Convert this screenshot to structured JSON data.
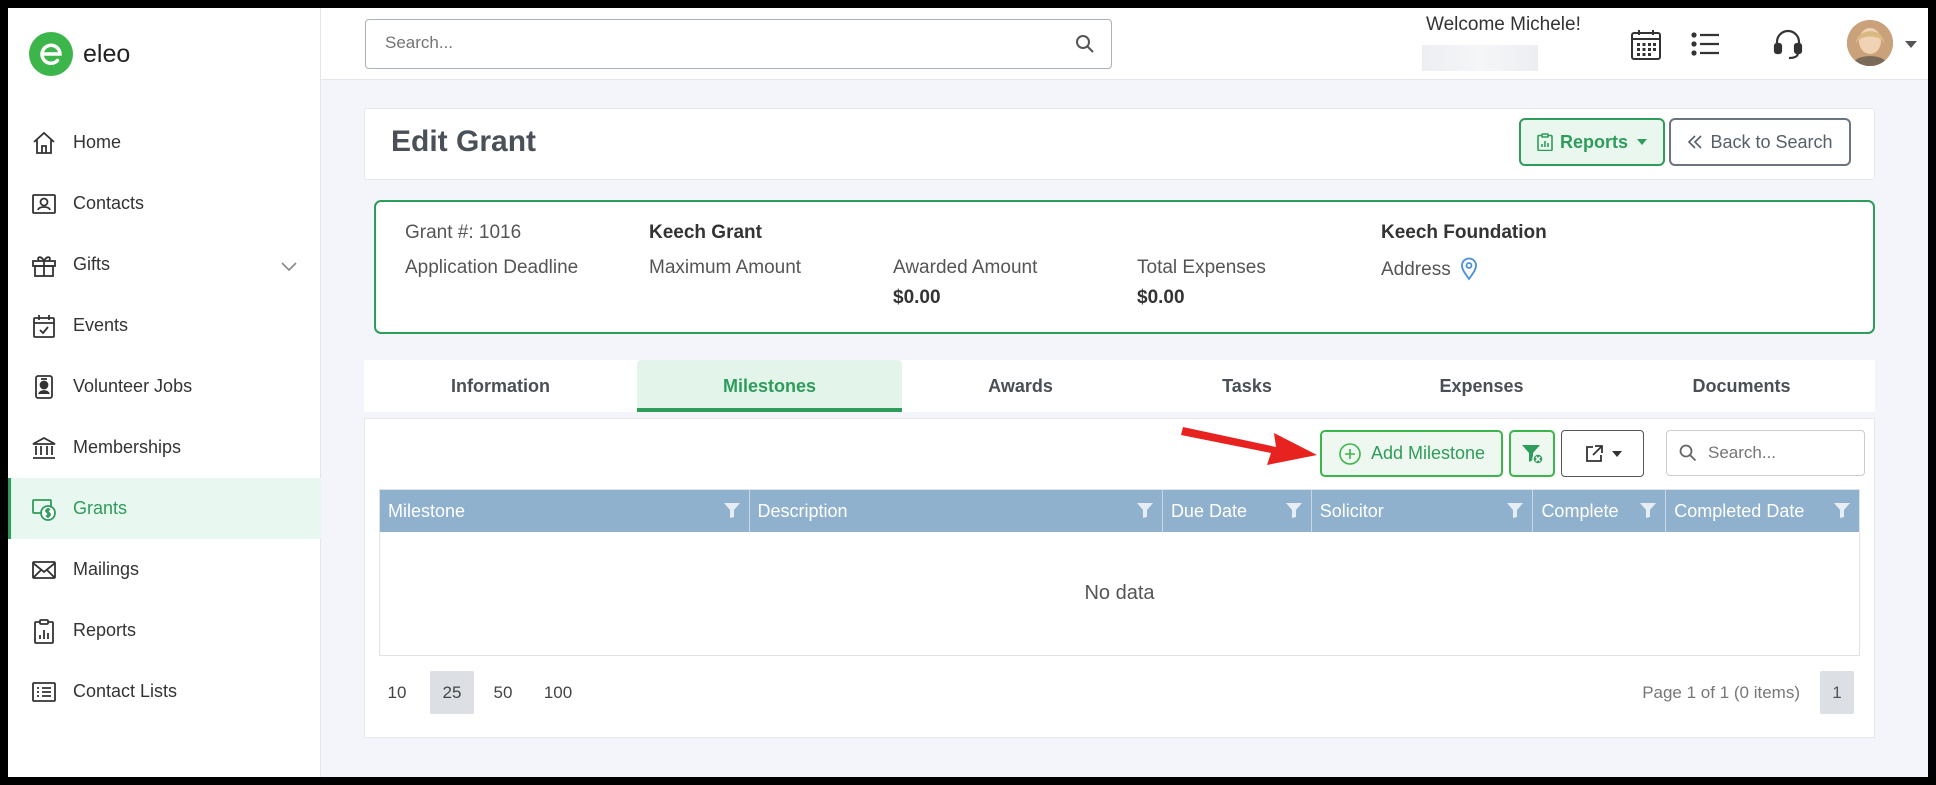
{
  "brand": {
    "name": "eleo",
    "accent": "#2e9c5a",
    "logo_color": "#3cb54a"
  },
  "sidebar": {
    "items": [
      {
        "label": "Home",
        "icon": "home-icon"
      },
      {
        "label": "Contacts",
        "icon": "contacts-icon"
      },
      {
        "label": "Gifts",
        "icon": "gift-icon",
        "expandable": true
      },
      {
        "label": "Events",
        "icon": "calendar-check-icon"
      },
      {
        "label": "Volunteer Jobs",
        "icon": "badge-icon"
      },
      {
        "label": "Memberships",
        "icon": "bank-icon"
      },
      {
        "label": "Grants",
        "icon": "grant-money-icon",
        "active": true
      },
      {
        "label": "Mailings",
        "icon": "envelope-icon"
      },
      {
        "label": "Reports",
        "icon": "clipboard-chart-icon"
      },
      {
        "label": "Contact Lists",
        "icon": "list-icon"
      }
    ]
  },
  "topbar": {
    "search_placeholder": "Search...",
    "welcome": "Welcome Michele!",
    "icons": [
      "calendar-grid-icon",
      "list-bullets-icon",
      "headset-icon",
      "user-avatar",
      "caret-down-icon"
    ]
  },
  "header": {
    "title": "Edit Grant",
    "reports_label": "Reports",
    "back_label": "Back to Search"
  },
  "summary": {
    "grant_number": "Grant #: 1016",
    "application_deadline": "Application Deadline",
    "grant_name": "Keech Grant",
    "maximum_amount_label": "Maximum Amount",
    "awarded_amount_label": "Awarded Amount",
    "awarded_amount_value": "$0.00",
    "total_expenses_label": "Total Expenses",
    "total_expenses_value": "$0.00",
    "foundation": "Keech Foundation",
    "address_label": "Address"
  },
  "tabs": [
    {
      "label": "Information"
    },
    {
      "label": "Milestones",
      "active": true
    },
    {
      "label": "Awards"
    },
    {
      "label": "Tasks"
    },
    {
      "label": "Expenses"
    },
    {
      "label": "Documents"
    }
  ],
  "grid": {
    "add_label": "Add Milestone",
    "search_placeholder": "Search...",
    "columns": [
      "Milestone",
      "Description",
      "Due Date",
      "Solicitor",
      "Complete",
      "Completed Date"
    ],
    "empty_text": "No data",
    "header_color": "#8fb1ce",
    "page_sizes": [
      "10",
      "25",
      "50",
      "100"
    ],
    "selected_page_size": "25",
    "page_info": "Page 1 of 1 (0 items)",
    "current_page": "1"
  },
  "annotation": {
    "arrow_color": "#e8231f"
  }
}
